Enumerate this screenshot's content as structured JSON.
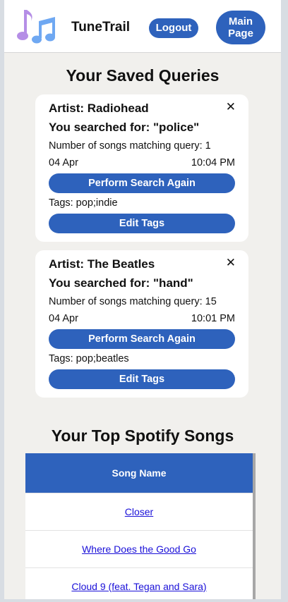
{
  "header": {
    "app_name": "TuneTrail",
    "logout_label": "Logout",
    "main_page_label": "Main\nPage"
  },
  "saved_queries": {
    "title": "Your Saved Queries",
    "close_glyph": "✕",
    "items": [
      {
        "artist": "Artist: Radiohead",
        "searched": "You searched for: \"police\"",
        "count": "Number of songs matching query: 1",
        "date": "04 Apr",
        "time": "10:04 PM",
        "perform_label": "Perform Search Again",
        "tags": "Tags: pop;indie",
        "edit_label": "Edit Tags"
      },
      {
        "artist": "Artist: The Beatles",
        "searched": "You searched for: \"hand\"",
        "count": "Number of songs matching query: 15",
        "date": "04 Apr",
        "time": "10:01 PM",
        "perform_label": "Perform Search Again",
        "tags": "Tags: pop;beatles",
        "edit_label": "Edit Tags"
      }
    ]
  },
  "top_songs": {
    "title": "Your Top Spotify Songs",
    "column_header": "Song Name",
    "rows": [
      "Closer",
      "Where Does the Good Go",
      "Cloud 9 (feat. Tegan and Sara)"
    ]
  },
  "icons": {
    "logo": "music-notes-icon",
    "close": "close-icon"
  },
  "colors": {
    "accent": "#2e62bc",
    "page_bg": "#f1f0ed",
    "card_bg": "#ffffff",
    "link": "#1a10d8",
    "logo_purple": "#b58ee6",
    "logo_blue": "#6fa8f2"
  }
}
